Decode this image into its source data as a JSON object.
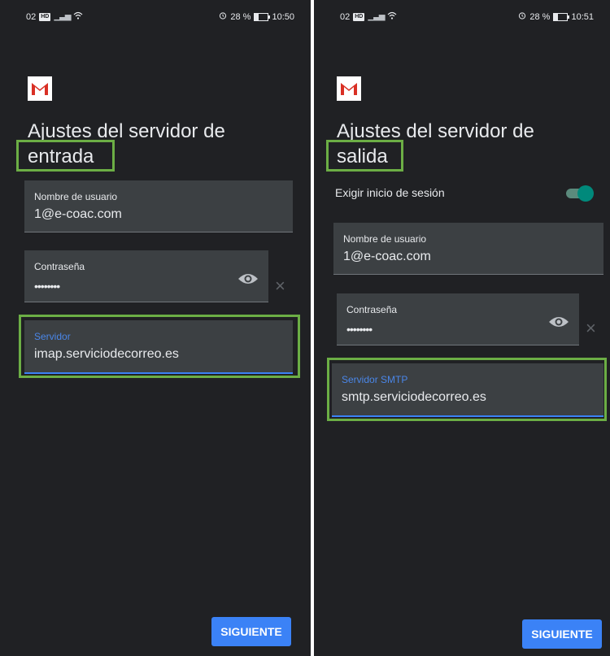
{
  "left_screen": {
    "status": {
      "carrier": "02",
      "network": "HD",
      "battery": "28 %",
      "time": "10:50"
    },
    "title_line1": "Ajustes del servidor de",
    "title_line2": "entrada",
    "username_label": "Nombre de usuario",
    "username_value": "1@e-coac.com",
    "password_label": "Contraseña",
    "password_value": "••••••••",
    "server_label": "Servidor",
    "server_value": "imap.serviciodecorreo.es",
    "next_button": "SIGUIENTE"
  },
  "right_screen": {
    "status": {
      "carrier": "02",
      "network": "HD",
      "battery": "28 %",
      "time": "10:51"
    },
    "title_line1": "Ajustes del servidor de",
    "title_line2": "salida",
    "require_login_label": "Exigir inicio de sesión",
    "require_login_enabled": true,
    "username_label": "Nombre de usuario",
    "username_value": "1@e-coac.com",
    "password_label": "Contraseña",
    "password_value": "••••••••",
    "server_label": "Servidor SMTP",
    "server_value": "smtp.serviciodecorreo.es",
    "next_button": "SIGUIENTE"
  },
  "colors": {
    "background": "#202124",
    "field": "#3c4043",
    "accent_blue": "#3b82f6",
    "highlight_green": "#6cae45",
    "toggle_teal": "#00897b"
  },
  "icons": [
    "gmail-logo",
    "eye-icon",
    "clear-icon",
    "alarm-icon",
    "battery-icon",
    "wifi-icon",
    "signal-icon"
  ]
}
